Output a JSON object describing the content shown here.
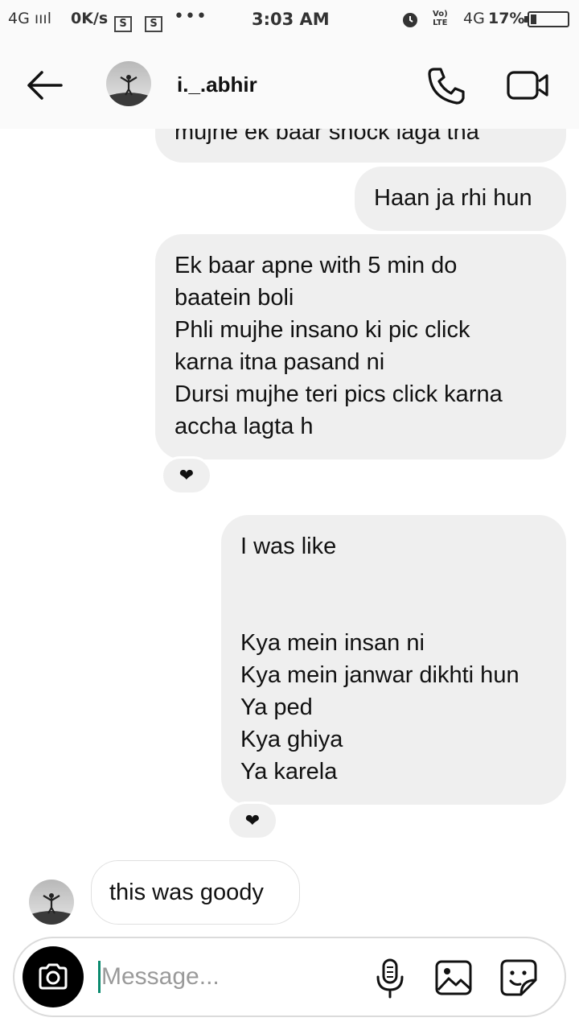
{
  "status_bar": {
    "network": "4G",
    "speed": "0K/s",
    "s_icon_1": "S",
    "s_icon_2": "S",
    "more": "•••",
    "time": "3:03 AM",
    "volte": "Vo)) LTE",
    "network_type": "4G",
    "battery_text": "17%",
    "battery_level": 0.17
  },
  "header": {
    "username": "i._.abhir"
  },
  "messages": [
    {
      "text": "mujhe ek baar shock laga tha"
    },
    {
      "text": "Haan ja rhi hun"
    },
    {
      "text": "Ek baar apne with 5 min do\nbaatein boli\nPhli mujhe insano ki pic click\nkarna itna pasand ni\nDursi mujhe teri pics click karna\naccha lagta h",
      "reaction": "❤"
    },
    {
      "text": "I was like\n\n\nKya mein insan ni\nKya mein janwar dikhti hun\nYa ped\nKya ghiya\nYa karela",
      "reaction": "❤"
    },
    {
      "text": "this was goody"
    }
  ],
  "composer": {
    "placeholder": "Message..."
  },
  "icons": {
    "back": "back-arrow-icon",
    "call": "phone-icon",
    "video": "video-camera-icon",
    "camera": "camera-icon",
    "mic": "microphone-icon",
    "gallery": "image-icon",
    "sticker": "sticker-icon"
  }
}
